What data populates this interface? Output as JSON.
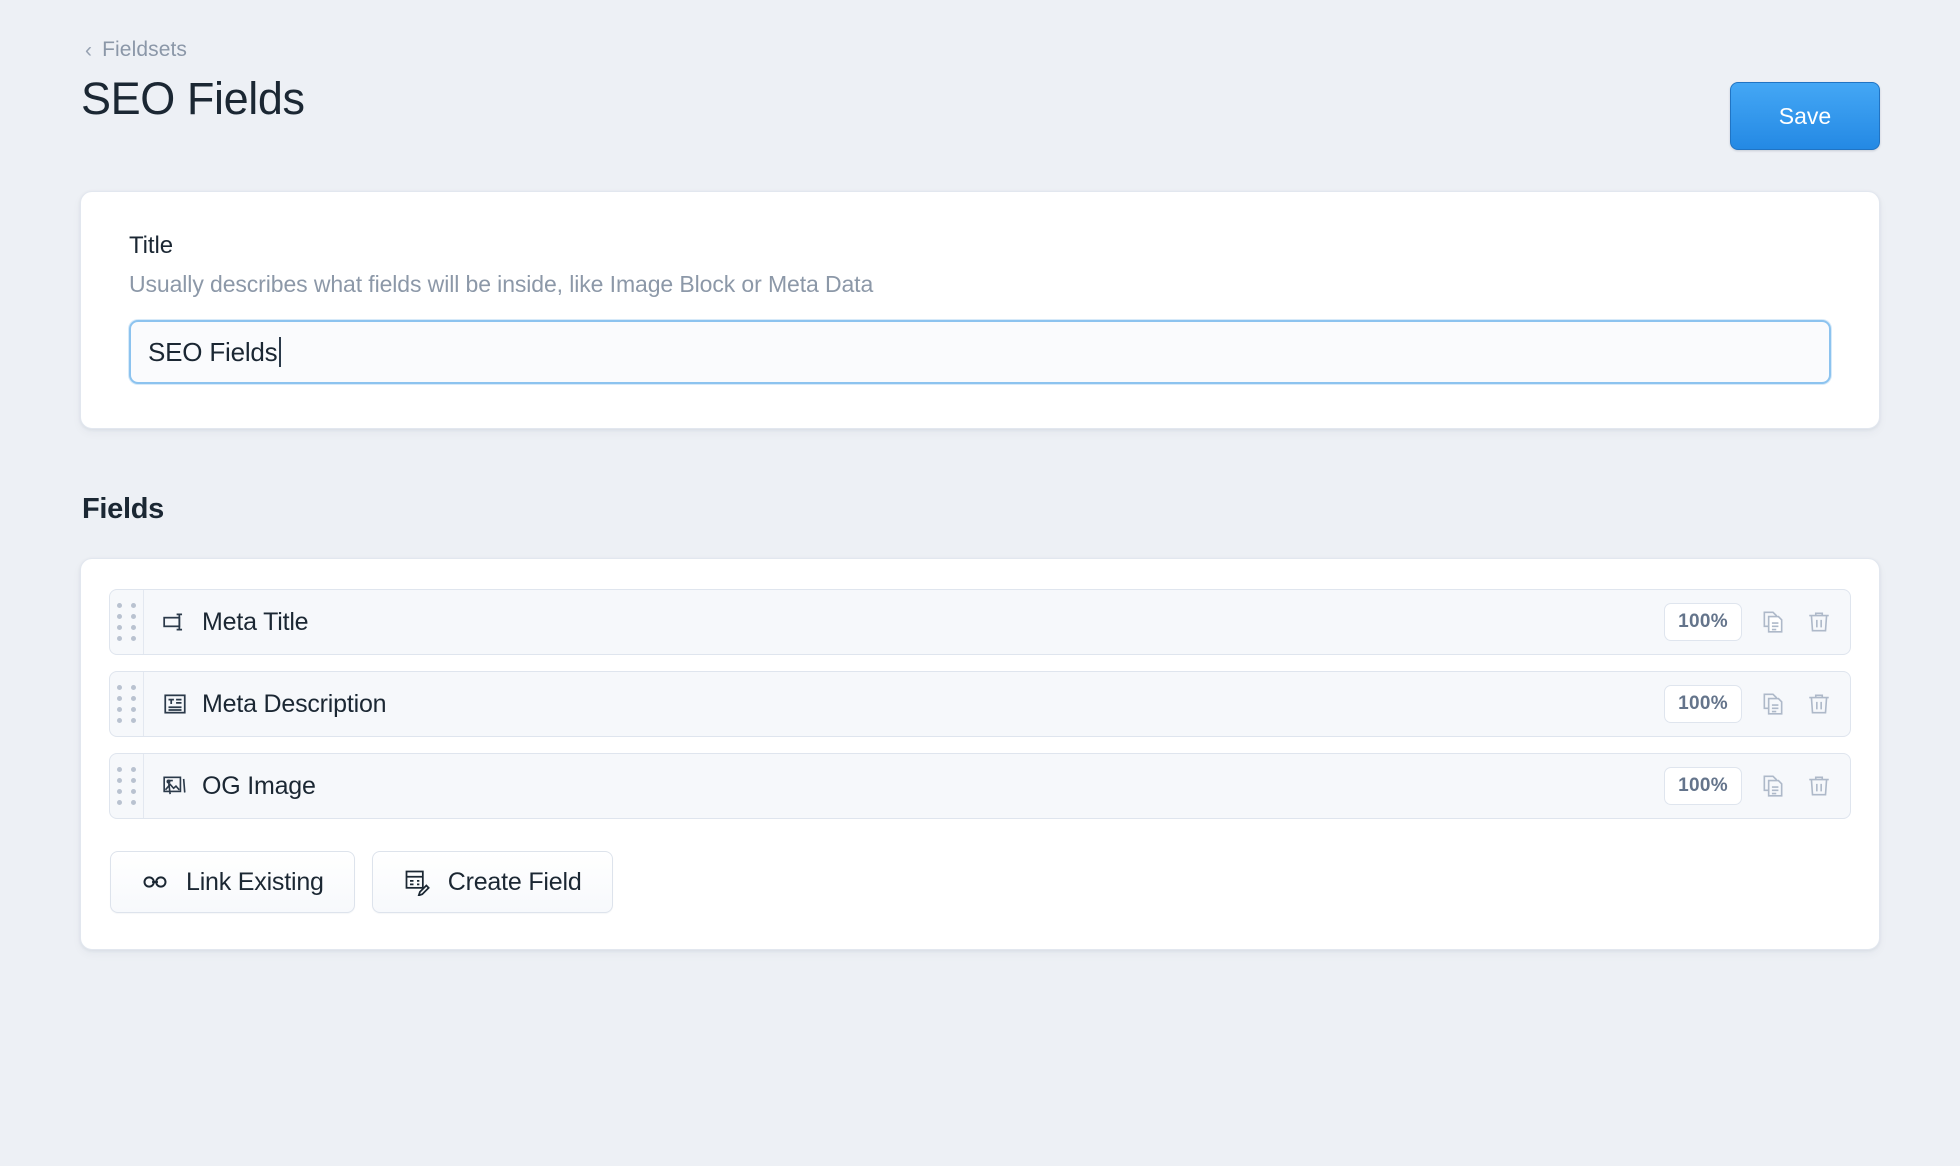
{
  "breadcrumb": {
    "label": "Fieldsets",
    "icon": "chevron-left-icon"
  },
  "header": {
    "title": "SEO Fields",
    "save_label": "Save",
    "accent_color": "#2489e4"
  },
  "title_card": {
    "label": "Title",
    "help": "Usually describes what fields will be inside, like Image Block or Meta Data",
    "input_value": "SEO Fields",
    "input_placeholder": "",
    "focus_ring_color": "#8cc3ef"
  },
  "fields_section": {
    "heading": "Fields",
    "rows": [
      {
        "name": "Meta Title",
        "icon": "text-input-icon",
        "width": "100%",
        "duplicate_icon": "copy-icon",
        "delete_icon": "trash-icon"
      },
      {
        "name": "Meta Description",
        "icon": "textarea-icon",
        "width": "100%",
        "duplicate_icon": "copy-icon",
        "delete_icon": "trash-icon"
      },
      {
        "name": "OG Image",
        "icon": "assets-icon",
        "width": "100%",
        "duplicate_icon": "copy-icon",
        "delete_icon": "trash-icon"
      }
    ],
    "buttons": [
      {
        "label": "Link Existing",
        "icon": "link-icon"
      },
      {
        "label": "Create Field",
        "icon": "form-pencil-icon"
      }
    ]
  },
  "colors": {
    "page_background": "#edf0f5",
    "card_background": "#ffffff",
    "row_background": "#f6f8fb",
    "text_primary": "#1b2733",
    "text_muted": "#8c98a8"
  }
}
